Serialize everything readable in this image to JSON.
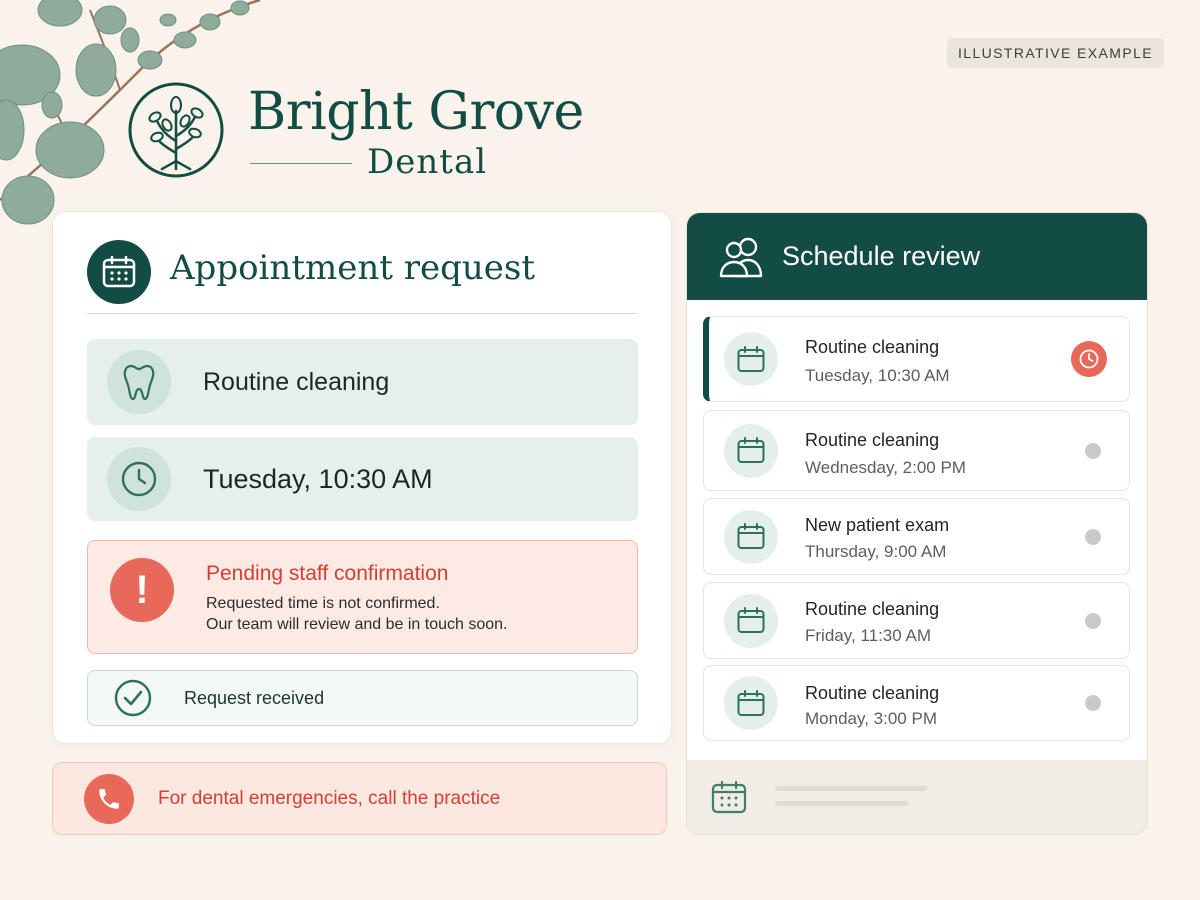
{
  "badge": "ILLUSTRATIVE EXAMPLE",
  "brand": {
    "name": "Bright Grove",
    "sub": "Dental"
  },
  "request": {
    "title": "Appointment request",
    "service": "Routine cleaning",
    "time": "Tuesday, 10:30 AM",
    "alert": {
      "title": "Pending staff confirmation",
      "line1": "Requested time is not confirmed.",
      "line2": "Our team will review and be in touch soon."
    },
    "received": "Request received"
  },
  "emergency": "For dental emergencies, call the practice",
  "schedule": {
    "title": "Schedule review",
    "items": [
      {
        "service": "Routine cleaning",
        "time": "Tuesday, 10:30 AM",
        "status": "pending"
      },
      {
        "service": "Routine cleaning",
        "time": "Wednesday, 2:00 PM",
        "status": "idle"
      },
      {
        "service": "New patient exam",
        "time": "Thursday, 9:00 AM",
        "status": "idle"
      },
      {
        "service": "Routine cleaning",
        "time": "Friday, 11:30 AM",
        "status": "idle"
      },
      {
        "service": "Routine cleaning",
        "time": "Monday, 3:00 PM",
        "status": "idle"
      }
    ]
  },
  "icons": {
    "logo": "tree-in-circle-icon",
    "title": "calendar-icon",
    "service": "tooth-icon",
    "time": "clock-icon",
    "alert": "exclamation-icon",
    "received": "check-circle-icon",
    "emergency": "phone-icon",
    "schedule": "people-icon",
    "pending": "alarm-clock-icon",
    "footer": "calendar-icon"
  },
  "colors": {
    "brand": "#134c44",
    "accent_red": "#d63e2f",
    "alert_bg": "#fdeae5",
    "background": "#f9f3ec"
  }
}
